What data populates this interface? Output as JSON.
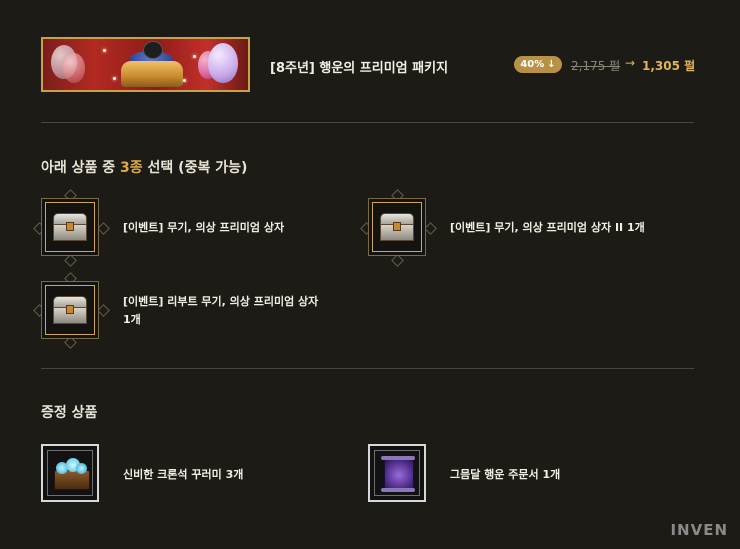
{
  "package": {
    "title": "[8주년] 행운의 프리미엄 패키지",
    "discount": "40%",
    "discount_arrow": "↓",
    "old_price": "2,175 펄",
    "arrow": "→",
    "new_price": "1,305 펄"
  },
  "selection": {
    "heading_prefix": "아래 상품 중 ",
    "heading_highlight": "3종",
    "heading_suffix": " 선택 (중복 가능)",
    "items": [
      {
        "label": "[이벤트] 무기, 의상 프리미엄 상자"
      },
      {
        "label": "[이벤트] 무기, 의상 프리미엄 상자 II 1개"
      },
      {
        "label_line1": "[이벤트] 리부트 무기, 의상 프리미엄 상자",
        "label_line2": "1개"
      }
    ]
  },
  "gifts": {
    "heading": "증정 상품",
    "items": [
      {
        "label": "신비한 크론석 꾸러미 3개"
      },
      {
        "label": "그믐달 행운 주문서 1개"
      }
    ]
  },
  "watermark": "INVEN",
  "colors": {
    "background": "#1d1b16",
    "accent_gold": "#e0a94a",
    "badge": "#b89149"
  }
}
